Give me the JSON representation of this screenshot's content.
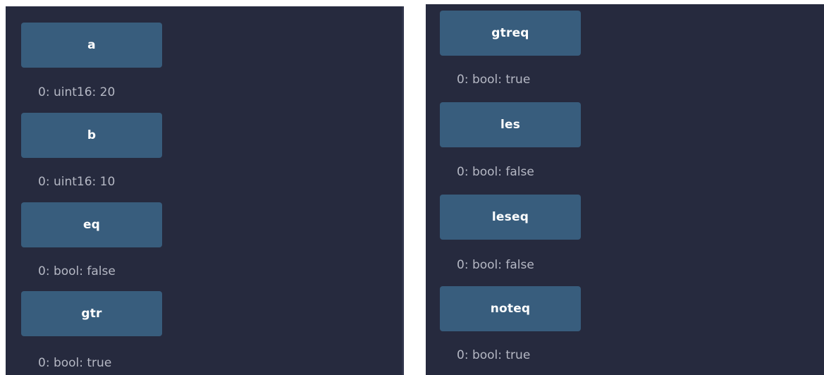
{
  "left_panel": {
    "functions": [
      {
        "label": "a",
        "result": "0: uint16: 20"
      },
      {
        "label": "b",
        "result": "0: uint16: 10"
      },
      {
        "label": "eq",
        "result": "0: bool: false"
      },
      {
        "label": "gtr",
        "result": "0: bool: true"
      }
    ]
  },
  "right_panel": {
    "functions": [
      {
        "label": "gtreq",
        "result": "0: bool: true"
      },
      {
        "label": "les",
        "result": "0: bool: false"
      },
      {
        "label": "leseq",
        "result": "0: bool: false"
      },
      {
        "label": "noteq",
        "result": "0: bool: true"
      }
    ]
  },
  "colors": {
    "panel_background": "#262a3e",
    "button_background": "#385d7d",
    "button_text": "#ffffff",
    "result_text": "#b5b8c4"
  }
}
